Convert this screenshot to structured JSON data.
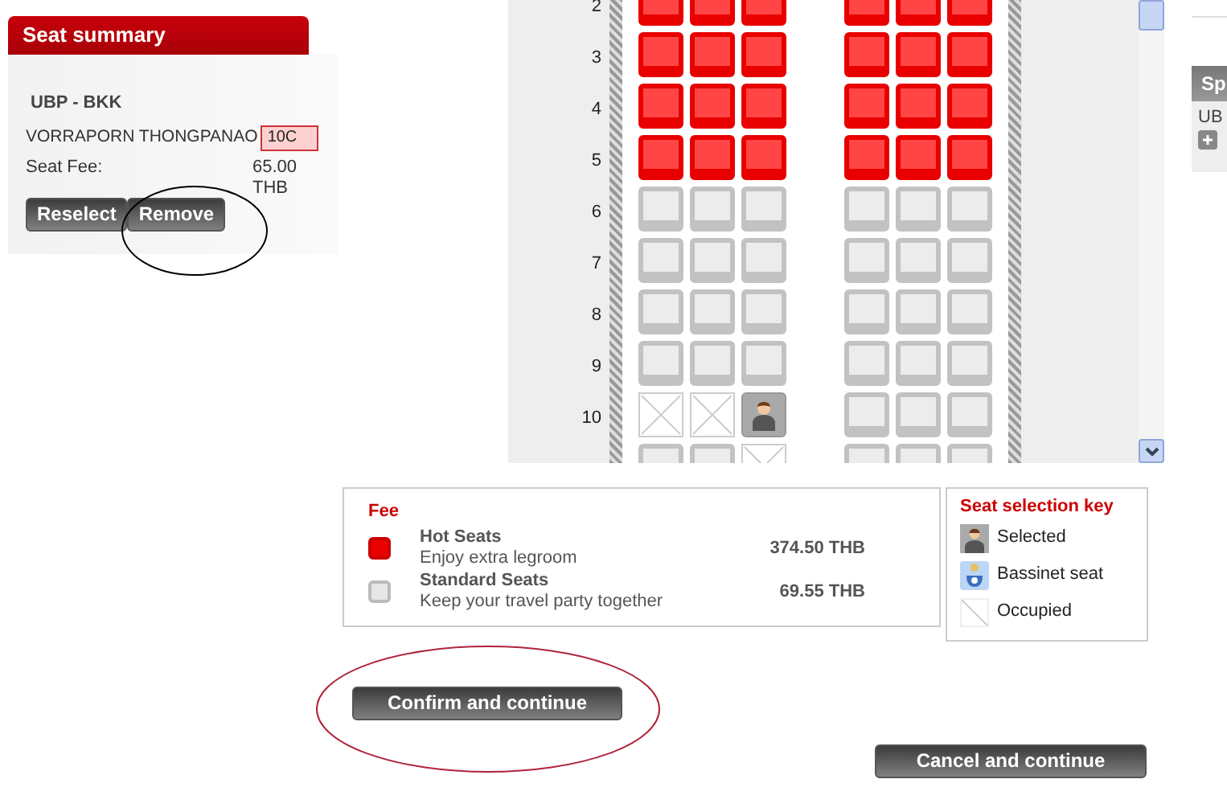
{
  "seat_summary": {
    "title": "Seat summary",
    "route": "UBP - BKK",
    "passenger": "VORRAPORN THONGPANAO",
    "seat": "10C",
    "fee_label": "Seat Fee:",
    "fee_value": "65.00 THB",
    "buttons": [
      "Reselect",
      "Remove"
    ]
  },
  "seat_map": {
    "rows": [
      {
        "number": "2",
        "seats": [
          {
            "kind": "hot"
          },
          {
            "kind": "hot"
          },
          {
            "kind": "hot"
          },
          {
            "kind": "hot"
          },
          {
            "kind": "hot"
          },
          {
            "kind": "hot"
          }
        ]
      },
      {
        "number": "3",
        "seats": [
          {
            "kind": "hot"
          },
          {
            "kind": "hot"
          },
          {
            "kind": "hot"
          },
          {
            "kind": "hot"
          },
          {
            "kind": "hot"
          },
          {
            "kind": "hot"
          }
        ]
      },
      {
        "number": "4",
        "seats": [
          {
            "kind": "hot"
          },
          {
            "kind": "hot"
          },
          {
            "kind": "hot"
          },
          {
            "kind": "hot"
          },
          {
            "kind": "hot"
          },
          {
            "kind": "hot"
          }
        ]
      },
      {
        "number": "5",
        "seats": [
          {
            "kind": "hot"
          },
          {
            "kind": "hot"
          },
          {
            "kind": "hot"
          },
          {
            "kind": "hot"
          },
          {
            "kind": "hot"
          },
          {
            "kind": "hot"
          }
        ]
      },
      {
        "number": "6",
        "seats": [
          {
            "kind": "standard"
          },
          {
            "kind": "standard"
          },
          {
            "kind": "standard"
          },
          {
            "kind": "standard"
          },
          {
            "kind": "standard"
          },
          {
            "kind": "standard"
          }
        ]
      },
      {
        "number": "7",
        "seats": [
          {
            "kind": "standard"
          },
          {
            "kind": "standard"
          },
          {
            "kind": "standard"
          },
          {
            "kind": "standard"
          },
          {
            "kind": "standard"
          },
          {
            "kind": "standard"
          }
        ]
      },
      {
        "number": "8",
        "seats": [
          {
            "kind": "standard"
          },
          {
            "kind": "standard"
          },
          {
            "kind": "standard"
          },
          {
            "kind": "standard"
          },
          {
            "kind": "standard"
          },
          {
            "kind": "standard"
          }
        ]
      },
      {
        "number": "9",
        "seats": [
          {
            "kind": "standard"
          },
          {
            "kind": "standard"
          },
          {
            "kind": "standard"
          },
          {
            "kind": "standard"
          },
          {
            "kind": "standard"
          },
          {
            "kind": "standard"
          }
        ]
      },
      {
        "number": "10",
        "seats": [
          {
            "kind": "occupied"
          },
          {
            "kind": "occupied"
          },
          {
            "kind": "selected"
          },
          {
            "kind": "standard"
          },
          {
            "kind": "standard"
          },
          {
            "kind": "standard"
          }
        ]
      },
      {
        "seats": [
          {
            "kind": "standard"
          },
          {
            "kind": "standard"
          },
          {
            "kind": "occupied"
          },
          {
            "kind": "standard"
          },
          {
            "kind": "standard"
          },
          {
            "kind": "standard"
          }
        ]
      }
    ]
  },
  "side_panel": {
    "title": "Sp",
    "text": "UB"
  },
  "fee_legend": {
    "title": "Fee",
    "items": [
      {
        "kind": "hot",
        "name": "Hot Seats",
        "description": "Enjoy extra legroom",
        "price": "374.50 THB"
      },
      {
        "kind": "standard",
        "name": "Standard Seats",
        "description": "Keep your travel party together",
        "price": "69.55 THB"
      }
    ]
  },
  "selection_key": {
    "title": "Seat selection key",
    "items": [
      {
        "kind": "selected",
        "label": "Selected"
      },
      {
        "kind": "bassinet",
        "label": "Bassinet seat"
      },
      {
        "kind": "occupied",
        "label": "Occupied"
      }
    ]
  },
  "buttons": {
    "confirm": "Confirm and continue",
    "cancel": "Cancel and continue"
  },
  "annotations": [
    {
      "kind": "remove",
      "color": "#000000"
    },
    {
      "kind": "confirm",
      "color": "#b0243a"
    }
  ]
}
